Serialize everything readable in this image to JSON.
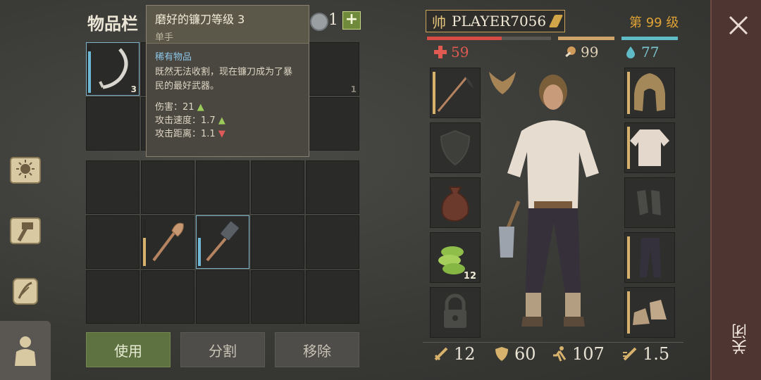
{
  "inventory": {
    "title": "物品栏",
    "coins": "1",
    "add_label": "+",
    "top_slots": [
      {
        "item": "sickle-icon",
        "count": "3",
        "fill": 0.9,
        "selected": true
      },
      {
        "item": "",
        "count": "1",
        "fill": 0,
        "selected": false
      },
      {
        "item": "",
        "count": "1",
        "fill": 0,
        "selected": false
      }
    ],
    "bottom_slots": [
      {
        "item": "shovel-icon",
        "fill": 0.6,
        "selected": false
      },
      {
        "item": "hammer-icon",
        "fill": 0.6,
        "selected": true
      }
    ],
    "buttons": {
      "use": "使用",
      "split": "分割",
      "remove": "移除"
    }
  },
  "tooltip": {
    "name": "磨好的镰刀等级 3",
    "hand": "单手",
    "rarity": "稀有物品",
    "desc": "既然无法收割，现在镰刀成为了暴民的最好武器。",
    "stats": [
      {
        "label": "伤害：",
        "value": "21",
        "trend": "▲"
      },
      {
        "label": "攻击速度：",
        "value": "1.7",
        "trend": "▲"
      },
      {
        "label": "攻击距离：",
        "value": "1.1",
        "trend": "▼"
      }
    ]
  },
  "player": {
    "rank": "帅",
    "name": "PLAYER7056",
    "level": "第 99 级",
    "health": "59",
    "food": "99",
    "water": "77",
    "health_fill": 0.6,
    "food_fill": 1.0,
    "water_fill": 1.0
  },
  "equipment": {
    "left": [
      {
        "name": "weapon-slot",
        "icon": "sickle-icon",
        "count": ""
      },
      {
        "name": "offhand-slot",
        "icon": "shield-icon",
        "count": ""
      },
      {
        "name": "bag-slot",
        "icon": "bag-icon",
        "count": ""
      },
      {
        "name": "food-slot",
        "icon": "herb-icon",
        "count": "12"
      },
      {
        "name": "locked-slot",
        "icon": "lock-icon",
        "count": ""
      }
    ],
    "right": [
      {
        "name": "head-slot",
        "icon": "hood-icon"
      },
      {
        "name": "chest-slot",
        "icon": "shirt-icon"
      },
      {
        "name": "hands-slot",
        "icon": "gloves-icon"
      },
      {
        "name": "legs-slot",
        "icon": "pants-icon"
      },
      {
        "name": "feet-slot",
        "icon": "boots-icon"
      }
    ]
  },
  "stats": {
    "attack": "12",
    "defense": "60",
    "speed": "107",
    "attack_speed": "1.5"
  },
  "close": {
    "label": "关闭"
  }
}
